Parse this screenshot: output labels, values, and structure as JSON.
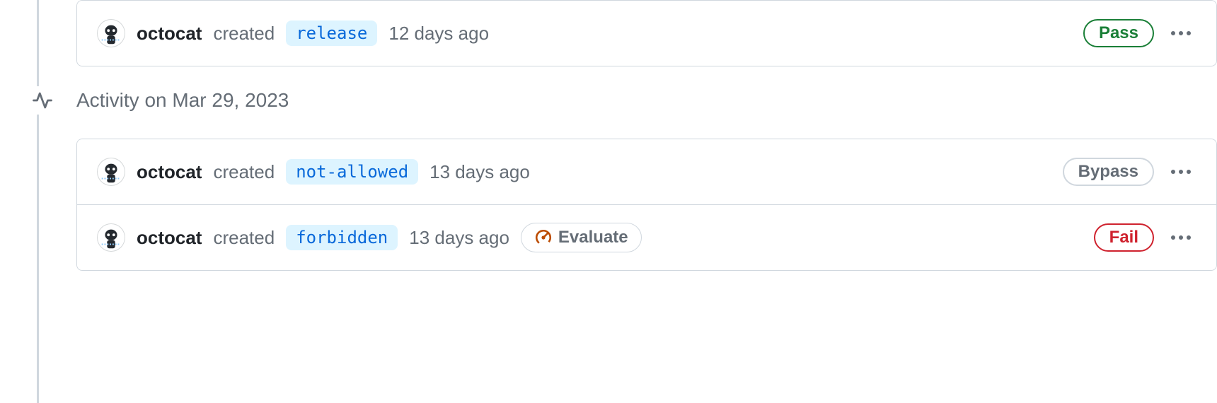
{
  "groups": [
    {
      "date_header": null,
      "items": [
        {
          "actor": "octocat",
          "action": "created",
          "ref": "release",
          "time": "12 days ago",
          "evaluate": null,
          "status": {
            "label": "Pass",
            "kind": "pass"
          }
        }
      ]
    },
    {
      "date_header": "Activity on Mar 29, 2023",
      "items": [
        {
          "actor": "octocat",
          "action": "created",
          "ref": "not-allowed",
          "time": "13 days ago",
          "evaluate": null,
          "status": {
            "label": "Bypass",
            "kind": "bypass"
          }
        },
        {
          "actor": "octocat",
          "action": "created",
          "ref": "forbidden",
          "time": "13 days ago",
          "evaluate": "Evaluate",
          "status": {
            "label": "Fail",
            "kind": "fail"
          }
        }
      ]
    }
  ]
}
